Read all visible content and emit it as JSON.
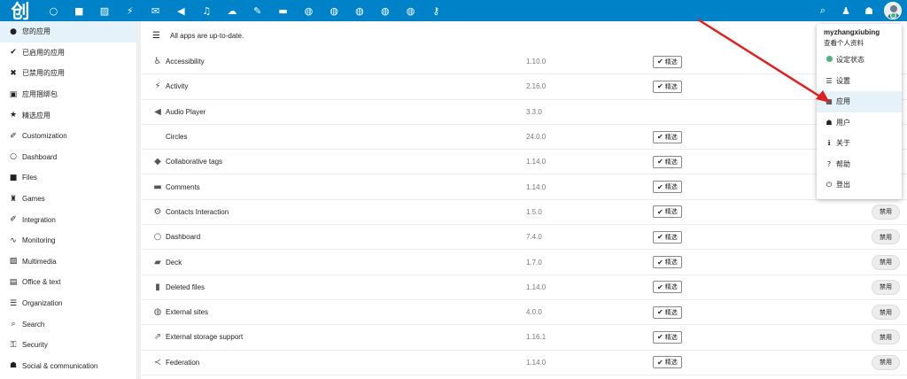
{
  "brand": {
    "logo_text": "创",
    "bar_color": "#0082c9",
    "accent_color": "#e02020"
  },
  "topbar": {
    "apps": [
      {
        "icon": "circle-icon",
        "glyph": "○"
      },
      {
        "icon": "folder-icon",
        "glyph": "■"
      },
      {
        "icon": "image-icon",
        "glyph": "▨"
      },
      {
        "icon": "activity-icon",
        "glyph": "⚡"
      },
      {
        "icon": "mail-icon",
        "glyph": "✉"
      },
      {
        "icon": "speaker-icon",
        "glyph": "◀"
      },
      {
        "icon": "music-icon",
        "glyph": "♫"
      },
      {
        "icon": "cloud-icon",
        "glyph": "☁"
      },
      {
        "icon": "pen-icon",
        "glyph": "✎"
      },
      {
        "icon": "deck-icon",
        "glyph": "▬"
      },
      {
        "icon": "globe-icon-1",
        "glyph": "◍"
      },
      {
        "icon": "globe-icon-2",
        "glyph": "◍"
      },
      {
        "icon": "globe-icon-3",
        "glyph": "◍"
      },
      {
        "icon": "globe-icon-4",
        "glyph": "◍"
      },
      {
        "icon": "globe-icon-5",
        "glyph": "◍"
      },
      {
        "icon": "key-icon",
        "glyph": "⚷"
      }
    ],
    "search_glyph": "⌕",
    "bell_glyph": "♟",
    "contacts_glyph": "☗"
  },
  "sidebar": {
    "items": [
      {
        "label": "您的应用",
        "glyph": "●"
      },
      {
        "label": "已启用的应用",
        "glyph": "✔"
      },
      {
        "label": "已禁用的应用",
        "glyph": "✖"
      },
      {
        "label": "应用捆绑包",
        "glyph": "▣"
      },
      {
        "label": "精选应用",
        "glyph": "★"
      },
      {
        "label": "Customization",
        "glyph": "✐"
      },
      {
        "label": "Dashboard",
        "glyph": "○"
      },
      {
        "label": "Files",
        "glyph": "■"
      },
      {
        "label": "Games",
        "glyph": "♜"
      },
      {
        "label": "Integration",
        "glyph": "✐"
      },
      {
        "label": "Monitoring",
        "glyph": "∿"
      },
      {
        "label": "Multimedia",
        "glyph": "▨"
      },
      {
        "label": "Office & text",
        "glyph": "▤"
      },
      {
        "label": "Organization",
        "glyph": "☰"
      },
      {
        "label": "Search",
        "glyph": "⌕"
      },
      {
        "label": "Security",
        "glyph": "⚿"
      },
      {
        "label": "Social & communication",
        "glyph": "☗"
      }
    ]
  },
  "main": {
    "notice": "All apps are up-to-date.",
    "featured_label": "精选",
    "disable_label": "禁用",
    "apps": [
      {
        "name": "Accessibility",
        "version": "1.10.0",
        "glyph": "♿",
        "featured": true,
        "disable": false
      },
      {
        "name": "Activity",
        "version": "2.16.0",
        "glyph": "⚡",
        "featured": true,
        "disable": false
      },
      {
        "name": "Audio Player",
        "version": "3.3.0",
        "glyph": "◀",
        "featured": false,
        "disable": false
      },
      {
        "name": "Circles",
        "version": "24.0.0",
        "glyph": "",
        "featured": true,
        "disable": false
      },
      {
        "name": "Collaborative tags",
        "version": "1.14.0",
        "glyph": "◆",
        "featured": true,
        "disable": false
      },
      {
        "name": "Comments",
        "version": "1.14.0",
        "glyph": "▬",
        "featured": true,
        "disable": false
      },
      {
        "name": "Contacts Interaction",
        "version": "1.5.0",
        "glyph": "⚙",
        "featured": true,
        "disable": true
      },
      {
        "name": "Dashboard",
        "version": "7.4.0",
        "glyph": "○",
        "featured": true,
        "disable": true
      },
      {
        "name": "Deck",
        "version": "1.7.0",
        "glyph": "▰",
        "featured": true,
        "disable": true
      },
      {
        "name": "Deleted files",
        "version": "1.14.0",
        "glyph": "▮",
        "featured": true,
        "disable": true
      },
      {
        "name": "External sites",
        "version": "4.0.0",
        "glyph": "◍",
        "featured": true,
        "disable": true
      },
      {
        "name": "External storage support",
        "version": "1.16.1",
        "glyph": "⇗",
        "featured": true,
        "disable": true
      },
      {
        "name": "Federation",
        "version": "1.14.0",
        "glyph": "≺",
        "featured": true,
        "disable": true
      }
    ]
  },
  "user_menu": {
    "username": "myzhangxiubing",
    "profile_link": "查看个人资料",
    "items": [
      {
        "label": "设定状态",
        "glyph": "●",
        "icon": "status-dot-icon"
      },
      {
        "label": "设置",
        "glyph": "☰",
        "icon": "settings-list-icon"
      },
      {
        "label": "应用",
        "glyph": "▦",
        "icon": "apps-icon"
      },
      {
        "label": "用户",
        "glyph": "☗",
        "icon": "users-icon"
      },
      {
        "label": "关于",
        "glyph": "ℹ",
        "icon": "info-icon"
      },
      {
        "label": "帮助",
        "glyph": "?",
        "icon": "help-icon"
      },
      {
        "label": "登出",
        "glyph": "⏻",
        "icon": "logout-icon"
      }
    ]
  }
}
